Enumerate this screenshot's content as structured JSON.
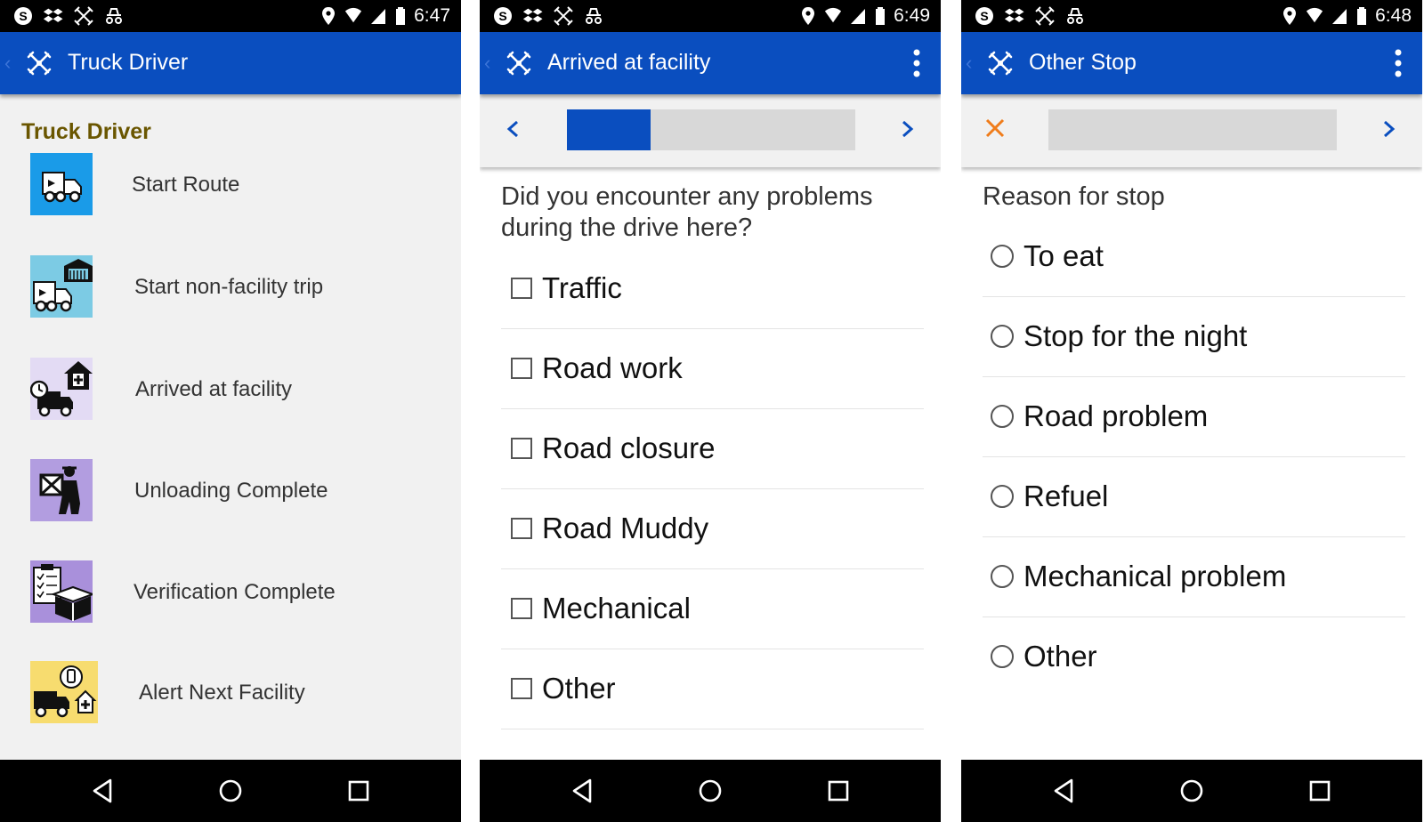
{
  "screens": [
    {
      "status_time": "6:47",
      "appbar_title": "Truck Driver",
      "section_title": "Truck Driver",
      "menu_items": [
        {
          "label": "Start Route",
          "icon": "truck-icon",
          "bg": "#1a9be8"
        },
        {
          "label": "Start non-facility trip",
          "icon": "truck-warehouse-icon",
          "bg": "#7ccbe4"
        },
        {
          "label": "Arrived at facility",
          "icon": "clock-truck-home-icon",
          "bg": "#e3dbf4"
        },
        {
          "label": "Unloading Complete",
          "icon": "worker-box-icon",
          "bg": "#b29de0"
        },
        {
          "label": "Verification Complete",
          "icon": "clipboard-box-icon",
          "bg": "#a990db"
        },
        {
          "label": "Alert Next Facility",
          "icon": "truck-alert-icon",
          "bg": "#f7dc6f"
        }
      ]
    },
    {
      "status_time": "6:49",
      "appbar_title": "Arrived at facility",
      "progress": 0.29,
      "question": "Did you encounter any problems during the drive here?",
      "options": [
        "Traffic",
        "Road work",
        "Road closure",
        "Road Muddy",
        "Mechanical",
        "Other"
      ]
    },
    {
      "status_time": "6:48",
      "appbar_title": "Other Stop",
      "progress": 0,
      "question": "Reason for stop",
      "options": [
        "To eat",
        "Stop for the night",
        "Road problem",
        "Refuel",
        "Mechanical problem",
        "Other"
      ]
    }
  ],
  "colors": {
    "appbar": "#0a4ebf",
    "section_title": "#6a5600",
    "cancel_x": "#f07c1a"
  }
}
